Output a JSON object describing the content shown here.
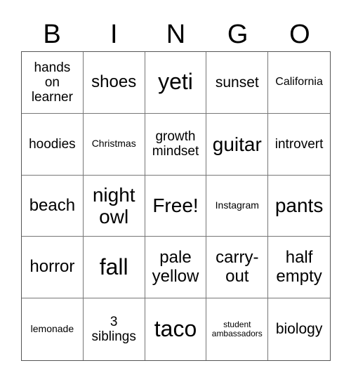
{
  "header": [
    "B",
    "I",
    "N",
    "G",
    "O"
  ],
  "cells": [
    "hands on learner",
    "shoes",
    "yeti",
    "sunset",
    "California",
    "hoodies",
    "Christmas",
    "growth mindset",
    "guitar",
    "introvert",
    "beach",
    "night owl",
    "Free!",
    "Instagram",
    "pants",
    "horror",
    "fall",
    "pale yellow",
    "carry-out",
    "half empty",
    "lemonade",
    "3 siblings",
    "taco",
    "student ambassadors",
    "biology"
  ],
  "cell_lines": [
    [
      "hands",
      "on",
      "learner"
    ],
    [
      "shoes"
    ],
    [
      "yeti"
    ],
    [
      "sunset"
    ],
    [
      "California"
    ],
    [
      "hoodies"
    ],
    [
      "Christmas"
    ],
    [
      "growth",
      "mindset"
    ],
    [
      "guitar"
    ],
    [
      "introvert"
    ],
    [
      "beach"
    ],
    [
      "night",
      "owl"
    ],
    [
      "Free!"
    ],
    [
      "Instagram"
    ],
    [
      "pants"
    ],
    [
      "horror"
    ],
    [
      "fall"
    ],
    [
      "pale",
      "yellow"
    ],
    [
      "carry-",
      "out"
    ],
    [
      "half",
      "empty"
    ],
    [
      "lemonade"
    ],
    [
      "3",
      "siblings"
    ],
    [
      "taco"
    ],
    [
      "student",
      "ambassadors"
    ],
    [
      "biology"
    ]
  ]
}
